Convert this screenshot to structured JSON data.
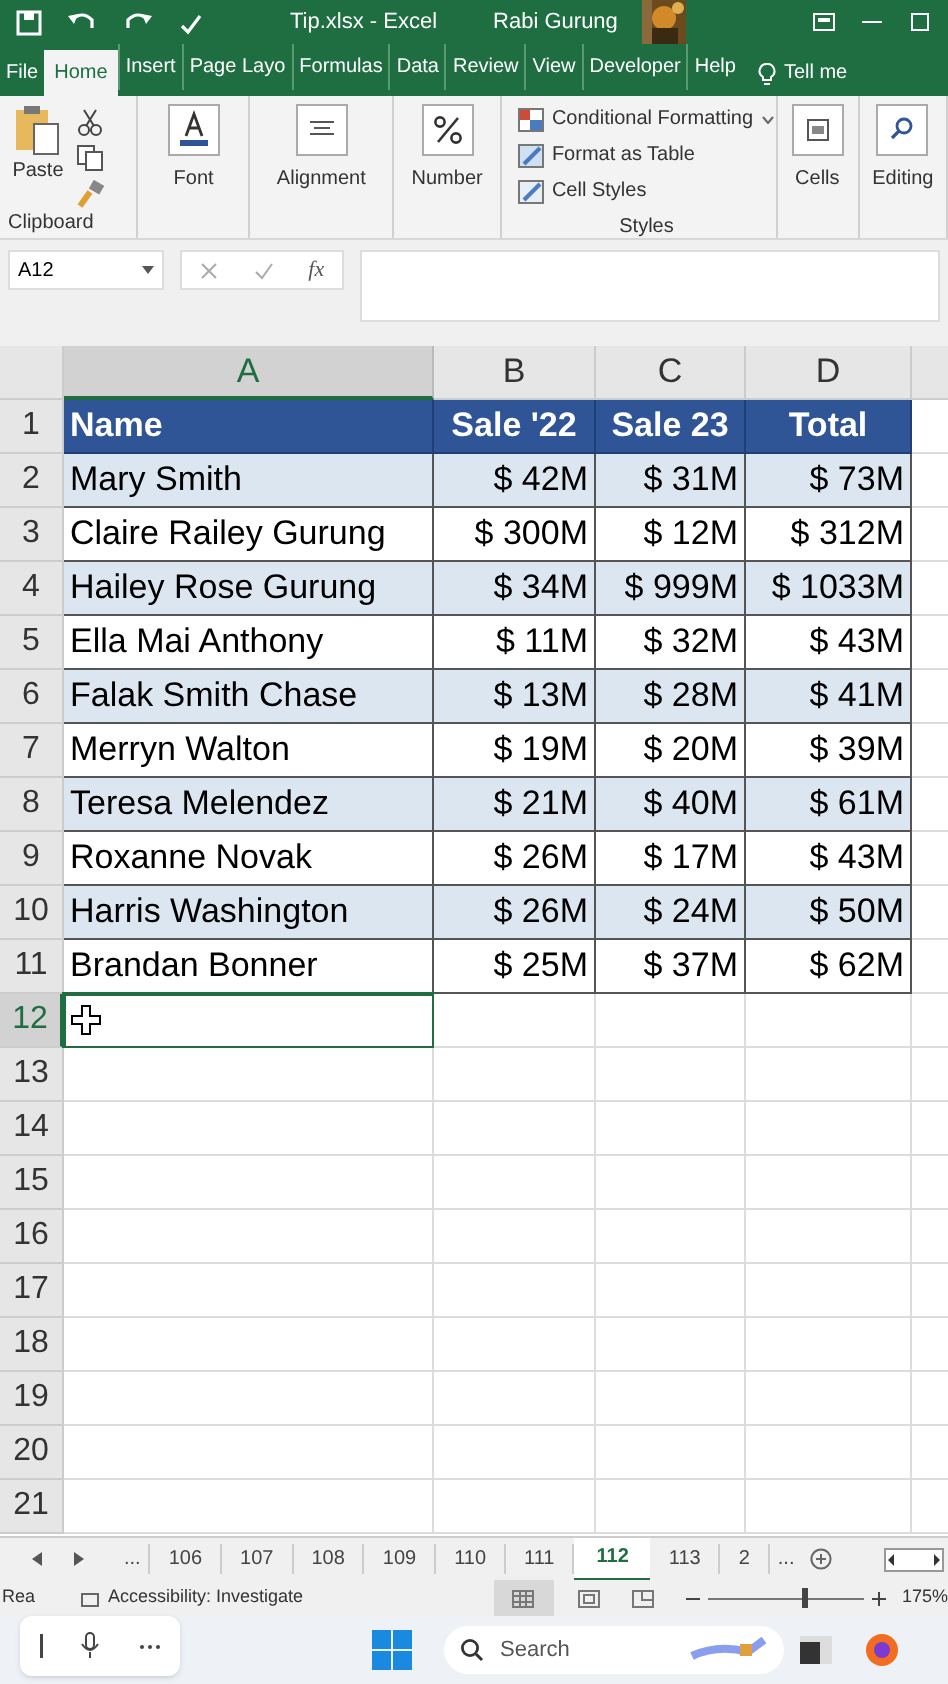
{
  "title_bar": {
    "title": "Tip.xlsx  -  Excel",
    "user": "Rabi Gurung"
  },
  "ribbon_tabs": [
    {
      "label": "File",
      "selected": false
    },
    {
      "label": "Home",
      "selected": true
    },
    {
      "label": "Insert",
      "selected": false
    },
    {
      "label": "Page Layo",
      "selected": false
    },
    {
      "label": "Formulas",
      "selected": false
    },
    {
      "label": "Data",
      "selected": false
    },
    {
      "label": "Review",
      "selected": false
    },
    {
      "label": "View",
      "selected": false
    },
    {
      "label": "Developer",
      "selected": false
    },
    {
      "label": "Help",
      "selected": false
    }
  ],
  "tell_me": "Tell me",
  "ribbon": {
    "paste": "Paste",
    "clipboard": "Clipboard",
    "font": "Font",
    "alignment": "Alignment",
    "number": "Number",
    "conditional_formatting": "Conditional Formatting",
    "format_as_table": "Format as Table",
    "cell_styles": "Cell Styles",
    "styles": "Styles",
    "cells": "Cells",
    "editing": "Editing"
  },
  "formula_bar": {
    "name_box": "A12",
    "function_label": "fx"
  },
  "columns": [
    {
      "label": "A",
      "selected": true
    },
    {
      "label": "B",
      "selected": false
    },
    {
      "label": "C",
      "selected": false
    },
    {
      "label": "D",
      "selected": false
    }
  ],
  "rows": [
    {
      "number": "1",
      "kind": "header",
      "selected": false,
      "cells": [
        "Name",
        "Sale '22",
        "Sale 23",
        "Total"
      ]
    },
    {
      "number": "2",
      "kind": "shaded",
      "selected": false,
      "cells": [
        "Mary Smith",
        "$ 42M",
        "$ 31M",
        "$ 73M"
      ]
    },
    {
      "number": "3",
      "kind": "plain",
      "selected": false,
      "cells": [
        "Claire Railey Gurung",
        "$ 300M",
        "$ 12M",
        "$ 312M"
      ]
    },
    {
      "number": "4",
      "kind": "shaded",
      "selected": false,
      "cells": [
        "Hailey Rose Gurung",
        "$ 34M",
        "$ 999M",
        "$ 1033M"
      ]
    },
    {
      "number": "5",
      "kind": "plain",
      "selected": false,
      "cells": [
        "Ella Mai Anthony",
        "$ 11M",
        "$ 32M",
        "$ 43M"
      ]
    },
    {
      "number": "6",
      "kind": "shaded",
      "selected": false,
      "cells": [
        "Falak Smith Chase",
        "$ 13M",
        "$ 28M",
        "$ 41M"
      ]
    },
    {
      "number": "7",
      "kind": "plain",
      "selected": false,
      "cells": [
        "Merryn Walton",
        "$ 19M",
        "$ 20M",
        "$ 39M"
      ]
    },
    {
      "number": "8",
      "kind": "shaded",
      "selected": false,
      "cells": [
        "Teresa Melendez",
        "$ 21M",
        "$ 40M",
        "$ 61M"
      ]
    },
    {
      "number": "9",
      "kind": "plain",
      "selected": false,
      "cells": [
        "Roxanne Novak",
        "$ 26M",
        "$ 17M",
        "$ 43M"
      ]
    },
    {
      "number": "10",
      "kind": "shaded",
      "selected": false,
      "cells": [
        "Harris Washington",
        "$ 26M",
        "$ 24M",
        "$ 50M"
      ]
    },
    {
      "number": "11",
      "kind": "plain",
      "selected": false,
      "cells": [
        "Brandan Bonner",
        "$ 25M",
        "$ 37M",
        "$ 62M"
      ]
    },
    {
      "number": "12",
      "kind": "empty",
      "selected": true
    },
    {
      "number": "13",
      "kind": "empty",
      "selected": false
    },
    {
      "number": "14",
      "kind": "empty",
      "selected": false
    },
    {
      "number": "15",
      "kind": "empty",
      "selected": false
    },
    {
      "number": "16",
      "kind": "empty",
      "selected": false
    },
    {
      "number": "17",
      "kind": "empty",
      "selected": false
    },
    {
      "number": "18",
      "kind": "empty",
      "selected": false
    },
    {
      "number": "19",
      "kind": "empty",
      "selected": false
    },
    {
      "number": "20",
      "kind": "empty",
      "selected": false
    },
    {
      "number": "21",
      "kind": "empty",
      "selected": false
    }
  ],
  "sheet_tabs": {
    "more_left": "...",
    "tabs": [
      {
        "label": "106",
        "selected": false
      },
      {
        "label": "107",
        "selected": false
      },
      {
        "label": "108",
        "selected": false
      },
      {
        "label": "109",
        "selected": false
      },
      {
        "label": "110",
        "selected": false
      },
      {
        "label": "111",
        "selected": false
      },
      {
        "label": "112",
        "selected": true
      },
      {
        "label": "113",
        "selected": false
      },
      {
        "label": "2",
        "selected": false
      }
    ],
    "more_right": "..."
  },
  "status_bar": {
    "ready": "Rea",
    "accessibility": "Accessibility: Investigate",
    "zoom": {
      "level": 0.63
    },
    "zoom_text": "175%"
  },
  "taskbar": {
    "search_placeholder": "Search"
  }
}
